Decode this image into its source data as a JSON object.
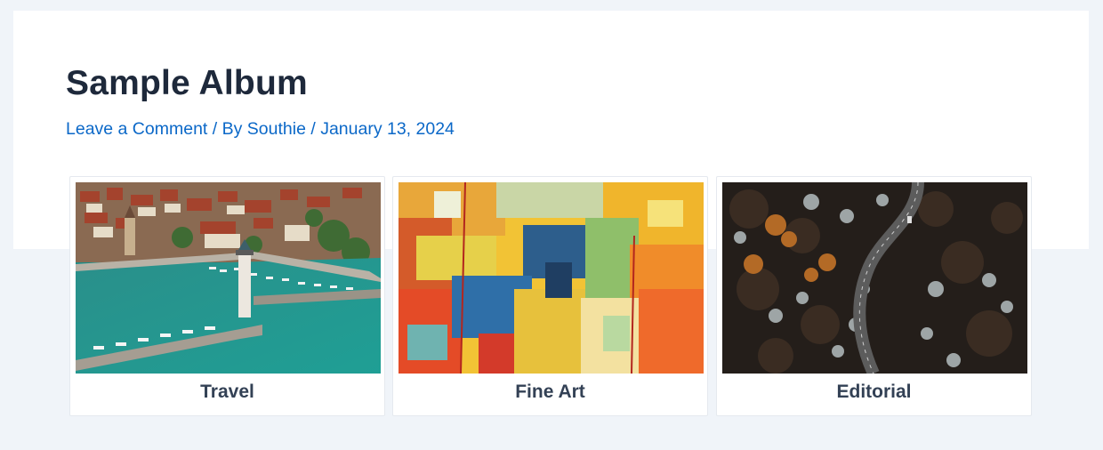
{
  "post": {
    "title": "Sample Album",
    "meta": {
      "comment_link": "Leave a Comment",
      "separator": "/",
      "by_prefix": "By",
      "author": "Southie",
      "date": "January 13, 2024"
    }
  },
  "albums": [
    {
      "label": "Travel",
      "image": "harbor-town-aerial-photo"
    },
    {
      "label": "Fine Art",
      "image": "abstract-colorful-painting"
    },
    {
      "label": "Editorial",
      "image": "forest-road-aerial-photo"
    }
  ],
  "colors": {
    "page_background": "#f0f4f9",
    "card_background": "#ffffff",
    "title": "#1e293b",
    "link": "#0b68c8",
    "caption": "#334155"
  }
}
